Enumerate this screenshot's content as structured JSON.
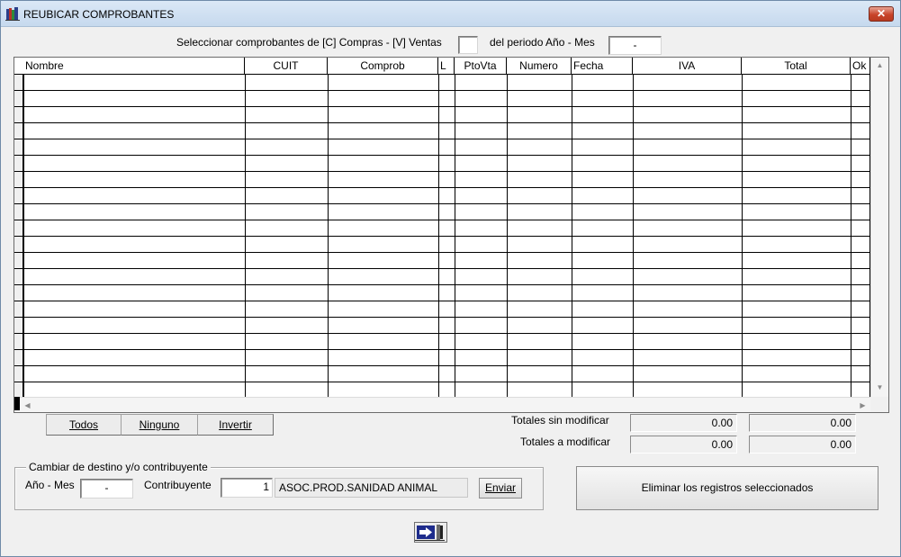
{
  "window": {
    "title": "REUBICAR COMPROBANTES",
    "close_glyph": "✕"
  },
  "filter": {
    "select_label": "Seleccionar comprobantes de [C] Compras - [V] Ventas",
    "type_value": "",
    "period_label": "del periodo Año - Mes",
    "period_value": "-"
  },
  "grid": {
    "columns": [
      "Nombre",
      "CUIT",
      "Comprob",
      "L",
      "PtoVta",
      "Numero",
      "Fecha",
      "IVA",
      "Total",
      "Ok"
    ],
    "rows": []
  },
  "selection_buttons": {
    "all": "Todos",
    "none": "Ninguno",
    "invert": "Invertir"
  },
  "totals": {
    "unmodified_label": "Totales sin modificar",
    "unmodified_iva": "0.00",
    "unmodified_total": "0.00",
    "modify_label": "Totales a modificar",
    "modify_iva": "0.00",
    "modify_total": "0.00"
  },
  "destination": {
    "group_title": "Cambiar de destino y/o contribuyente",
    "period_label": "Año - Mes",
    "period_value": "-",
    "taxpayer_label": "Contribuyente",
    "taxpayer_code": "1",
    "taxpayer_name": "ASOC.PROD.SANIDAD ANIMAL",
    "send_label": "Enviar"
  },
  "delete_button": "Eliminar los registros seleccionados",
  "icons": {
    "app": "app-books-icon",
    "exit": "exit-door-icon"
  }
}
